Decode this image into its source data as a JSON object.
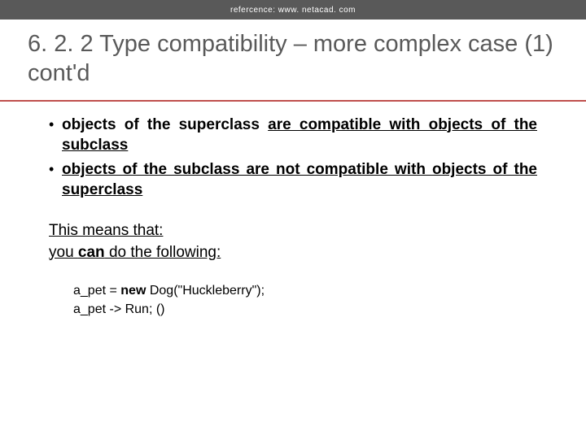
{
  "topbar": {
    "reference": "refercence: www. netacad. com"
  },
  "title": "6. 2. 2 Type compatibility – more complex case (1) cont'd",
  "bullets": [
    {
      "lead": "objects of the superclass ",
      "u1": "are compatible with objects of the subclass"
    },
    {
      "u1": " objects of the subclass are not compatible with objects of the superclass"
    }
  ],
  "means": {
    "line1": "This means that:",
    "line2_pre": " you ",
    "line2_b": "can",
    "line2_post": " do the following:"
  },
  "code": {
    "l1_pre": "a_pet = ",
    "l1_kw": "new",
    "l1_post": " Dog(\"Huckleberry\");",
    "l2": "a_pet -> Run; ()"
  }
}
